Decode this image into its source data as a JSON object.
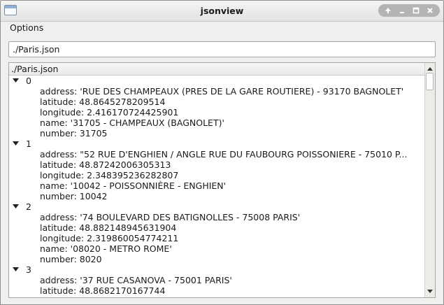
{
  "window": {
    "title": "jsonview"
  },
  "menu": {
    "options_label": "Options"
  },
  "path_input": {
    "value": "./Paris.json"
  },
  "tree": {
    "header": "./Paris.json",
    "items": [
      {
        "index": "0",
        "fields": [
          "address: 'RUE DES CHAMPEAUX (PRES DE LA GARE ROUTIERE) - 93170 BAGNOLET'",
          "latitude: 48.8645278209514",
          "longitude: 2.416170724425901",
          "name: '31705 - CHAMPEAUX (BAGNOLET)'",
          "number: 31705"
        ]
      },
      {
        "index": "1",
        "fields": [
          "address: \"52 RUE D'ENGHIEN / ANGLE RUE DU FAUBOURG POISSONIERE - 75010 P...",
          "latitude: 48.87242006305313",
          "longitude: 2.348395236282807",
          "name: '10042 - POISSONNIÈRE - ENGHIEN'",
          "number: 10042"
        ]
      },
      {
        "index": "2",
        "fields": [
          "address: '74 BOULEVARD DES BATIGNOLLES - 75008 PARIS'",
          "latitude: 48.882148945631904",
          "longitude: 2.319860054774211",
          "name: '08020 - METRO ROME'",
          "number: 8020"
        ]
      },
      {
        "index": "3",
        "fields": [
          "address: '37 RUE CASANOVA - 75001 PARIS'",
          "latitude: 48.8682170167744"
        ]
      }
    ]
  },
  "icons": {
    "app": "app-window-icon",
    "up": "arrow-up-icon",
    "minimize": "minimize-icon",
    "maximize": "maximize-icon",
    "close": "close-icon",
    "expanded": "triangle-down-icon",
    "scroll_up": "scroll-up-icon",
    "scroll_down": "scroll-down-icon"
  }
}
